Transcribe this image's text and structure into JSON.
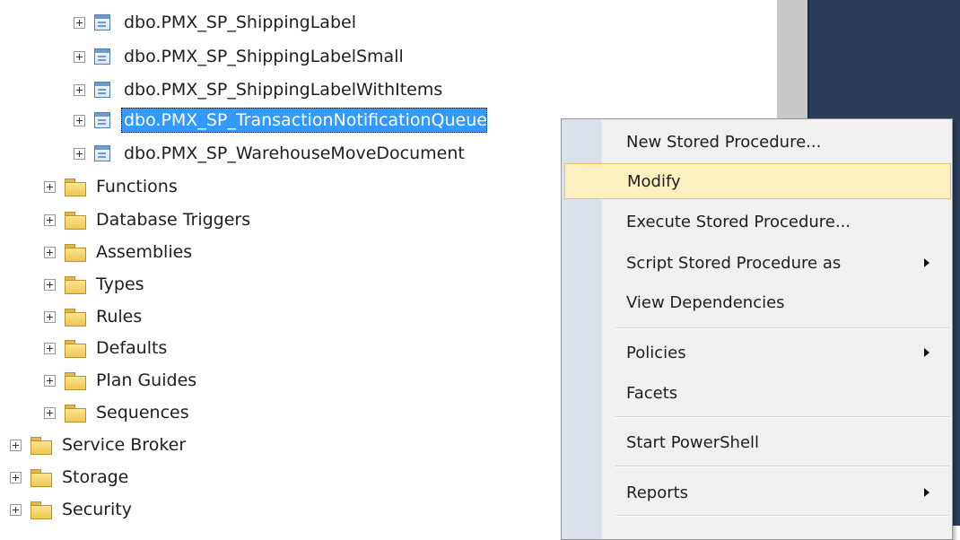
{
  "tree": {
    "procedures": [
      "dbo.PMX_SP_ShippingLabel",
      "dbo.PMX_SP_ShippingLabelSmall",
      "dbo.PMX_SP_ShippingLabelWithItems",
      "dbo.PMX_SP_TransactionNotificationQueue",
      "dbo.PMX_SP_WarehouseMoveDocument"
    ],
    "db_folders": [
      "Functions",
      "Database Triggers",
      "Assemblies",
      "Types",
      "Rules",
      "Defaults",
      "Plan Guides",
      "Sequences"
    ],
    "root_folders": [
      "Service Broker",
      "Storage",
      "Security"
    ]
  },
  "context_menu": {
    "new_stored_procedure": "New Stored Procedure...",
    "modify": "Modify",
    "execute_stored_procedure": "Execute Stored Procedure...",
    "script_stored_procedure_as": "Script Stored Procedure as",
    "view_dependencies": "View Dependencies",
    "policies": "Policies",
    "facets": "Facets",
    "start_powershell": "Start PowerShell",
    "reports": "Reports"
  },
  "colors": {
    "selection": "#3399ff",
    "menu_highlight": "#fcf0c1",
    "side_panel": "#2b3c59"
  }
}
